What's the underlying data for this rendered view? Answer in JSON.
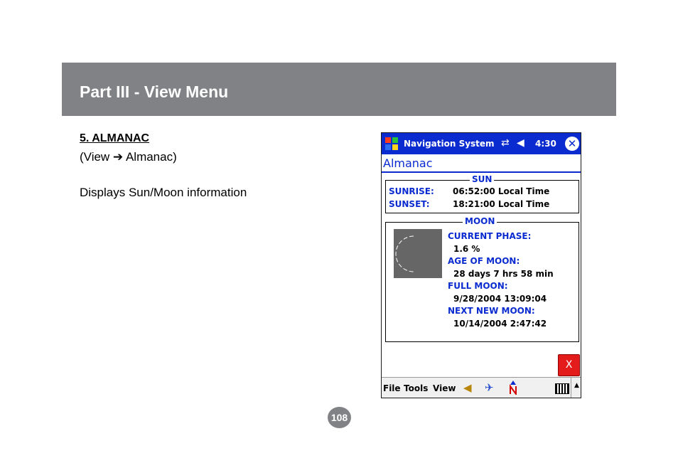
{
  "header": {
    "title": "Part III - View Menu"
  },
  "section": {
    "heading": "5. ALMANAC",
    "path": "(View ➔ Almanac)",
    "description": "Displays Sun/Moon information"
  },
  "device": {
    "title_bar": {
      "app_name": "Navigation System",
      "time": "4:30",
      "close_symbol": "✕"
    },
    "page_title": "Almanac",
    "sun": {
      "legend": "SUN",
      "sunrise_label": "SUNRISE:",
      "sunrise_value": "06:52:00 Local Time",
      "sunset_label": "SUNSET:",
      "sunset_value": "18:21:00 Local Time"
    },
    "moon": {
      "legend": "MOON",
      "current_phase_label": "CURRENT PHASE:",
      "current_phase_value": "1.6 %",
      "age_label": "AGE OF MOON:",
      "age_value": "28 days 7 hrs 58 min",
      "full_moon_label": "FULL MOON:",
      "full_moon_value": "9/28/2004 13:09:04",
      "next_new_moon_label": "NEXT NEW MOON:",
      "next_new_moon_value": "10/14/2004 2:47:42"
    },
    "exit_button": "X",
    "menu": {
      "file": "File",
      "tools": "Tools",
      "view": "View"
    },
    "icons": [
      "windows-start-icon",
      "connectivity-icon",
      "speaker-icon",
      "close-icon",
      "speaker-icon",
      "satellite-icon",
      "north-compass-icon",
      "keyboard-icon",
      "up-arrow-icon"
    ],
    "colors": {
      "title_bar": "#0a2bd0",
      "label_text": "#0a2bd0",
      "exit_button": "#e31b1b"
    }
  },
  "page_number": "108",
  "colors": {
    "banner": "#808285"
  }
}
